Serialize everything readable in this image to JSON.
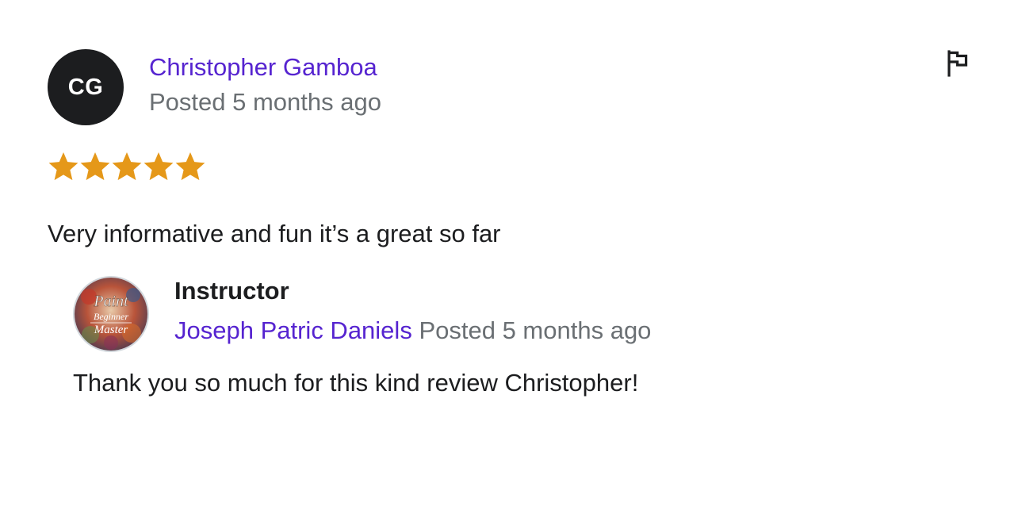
{
  "review": {
    "avatar_initials": "CG",
    "reviewer_name": "Christopher Gamboa",
    "posted": "Posted 5 months ago",
    "rating": 5,
    "rating_max": 5,
    "text": "Very informative and fun it’s a great so far",
    "report_icon": "flag-icon"
  },
  "response": {
    "title": "Instructor",
    "instructor_name": "Joseph Patric Daniels",
    "posted": "Posted 5 months ago",
    "text": "Thank you so much for this kind review Christopher!",
    "avatar_logo_text": [
      "Paint",
      "Beginner",
      "Master"
    ]
  },
  "colors": {
    "accent": "#5624d0",
    "muted": "#6a6f73",
    "text": "#1c1d1f",
    "star": "#e59819"
  }
}
